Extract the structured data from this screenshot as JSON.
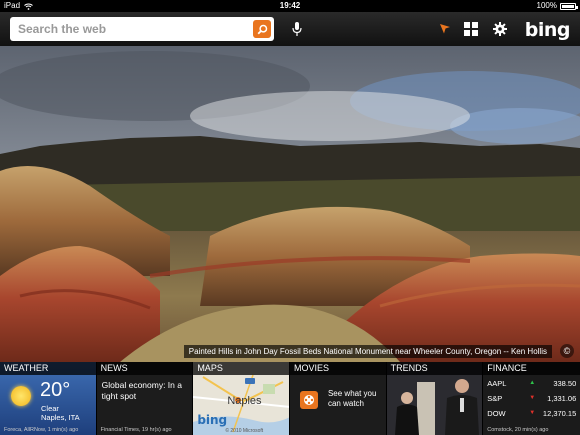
{
  "status_bar": {
    "device": "iPad",
    "time": "19:42",
    "battery": "100%"
  },
  "toolbar": {
    "search_placeholder": "Search the web",
    "logo": "bing",
    "icons": [
      "search-icon",
      "microphone-icon",
      "location-arrow-icon",
      "apps-grid-icon",
      "gear-icon"
    ],
    "accent_color": "#e9751f"
  },
  "hero": {
    "caption": "Painted Hills in John Day Fossil Beds National Monument near Wheeler County, Oregon -- Ken Hollis",
    "copyright_symbol": "©"
  },
  "tiles": {
    "weather": {
      "title": "WEATHER",
      "temperature": "20°",
      "condition": "Clear",
      "location": "Naples, ITA",
      "source": "Foreca, AllRNow, 1 min(s) ago"
    },
    "news": {
      "title": "NEWS",
      "headline": "Global economy: In a tight spot",
      "source": "Financial Times, 19 hr(s) ago"
    },
    "maps": {
      "title": "MAPS",
      "city": "Naples",
      "logo": "bing",
      "copyright": "© 2010 Microsoft"
    },
    "movies": {
      "title": "MOVIES",
      "text": "See what you can watch"
    },
    "trends": {
      "title": "TRENDS"
    },
    "finance": {
      "title": "FINANCE",
      "rows": [
        {
          "symbol": "AAPL",
          "direction": "up",
          "value": "338.50"
        },
        {
          "symbol": "S&P",
          "direction": "down",
          "value": "1,331.06"
        },
        {
          "symbol": "DOW",
          "direction": "down",
          "value": "12,370.15"
        }
      ],
      "source": "Comstock, 20 min(s) ago",
      "up_color": "#2ec24a",
      "down_color": "#e0312b"
    }
  }
}
